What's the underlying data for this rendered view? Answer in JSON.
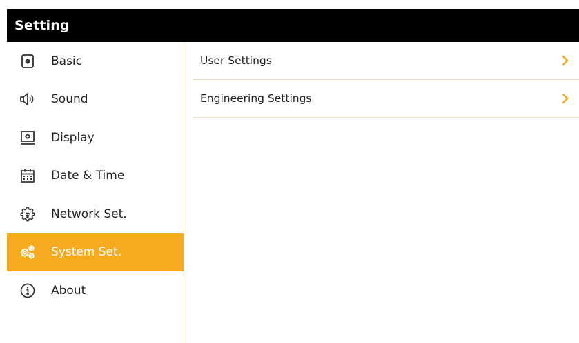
{
  "app": {
    "title": "Setting"
  },
  "sidebar": {
    "items": [
      {
        "label": "Basic",
        "icon": "basic-icon",
        "active": false
      },
      {
        "label": "Sound",
        "icon": "speaker-icon",
        "active": false
      },
      {
        "label": "Display",
        "icon": "display-icon",
        "active": false
      },
      {
        "label": "Date & Time",
        "icon": "calendar-icon",
        "active": false
      },
      {
        "label": "Network Set.",
        "icon": "network-gear-icon",
        "active": false
      },
      {
        "label": "System Set.",
        "icon": "gears-icon",
        "active": true
      },
      {
        "label": "About",
        "icon": "info-icon",
        "active": false
      }
    ]
  },
  "main": {
    "rows": [
      {
        "label": "User Settings",
        "icon": "chevron-right-icon"
      },
      {
        "label": "Engineering Settings",
        "icon": "chevron-right-icon"
      }
    ]
  },
  "colors": {
    "accent": "#f5aa1f",
    "titlebar": "#000000",
    "divider": "#f6e3bd"
  }
}
